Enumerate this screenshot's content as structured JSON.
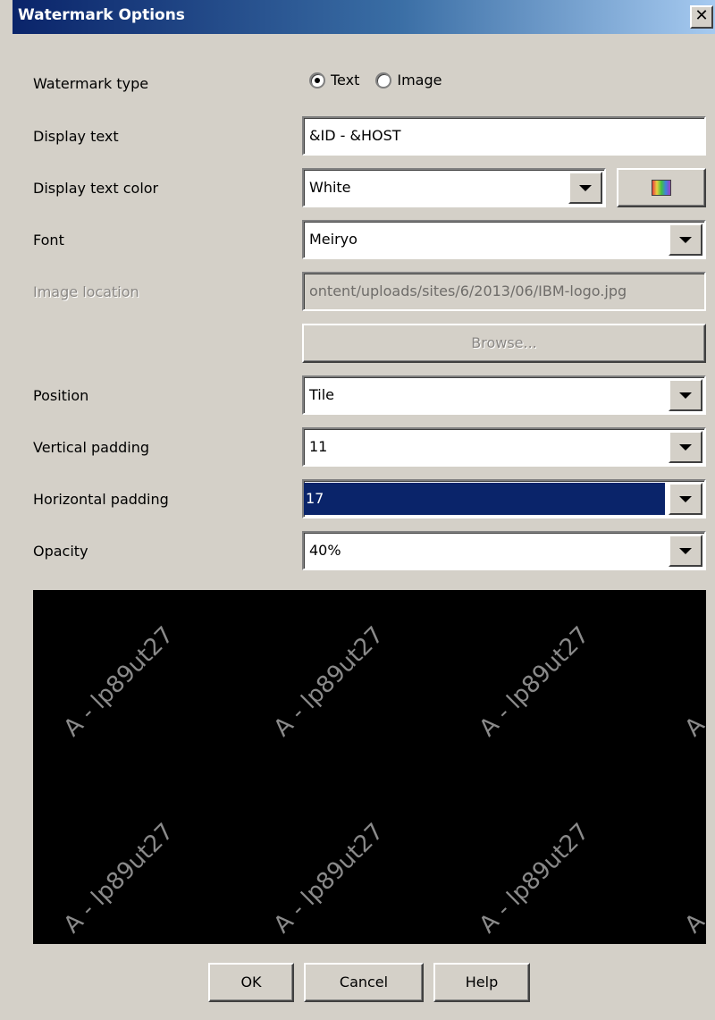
{
  "window": {
    "title": "Watermark Options",
    "close_glyph": "✕"
  },
  "form": {
    "watermark_type": {
      "label": "Watermark type",
      "options": [
        {
          "label": "Text",
          "selected": true
        },
        {
          "label": "Image",
          "selected": false
        }
      ]
    },
    "display_text": {
      "label": "Display text",
      "value": "&ID - &HOST"
    },
    "display_text_color": {
      "label": "Display text color",
      "value": "White",
      "picker_icon": "color-palette-icon"
    },
    "font": {
      "label": "Font",
      "value": "Meiryo"
    },
    "image_location": {
      "label": "Image location",
      "value": "ontent/uploads/sites/6/2013/06/IBM-logo.jpg",
      "enabled": false
    },
    "browse_button": {
      "label": "Browse...",
      "enabled": false
    },
    "position": {
      "label": "Position",
      "value": "Tile"
    },
    "vertical_padding": {
      "label": "Vertical padding",
      "value": "11"
    },
    "horizontal_padding": {
      "label": "Horizontal padding",
      "value": "17",
      "selected": true
    },
    "opacity": {
      "label": "Opacity",
      "value": "40%"
    }
  },
  "preview": {
    "background": "#000000",
    "watermark_text": "A - lp89ut27"
  },
  "buttons": {
    "ok": "OK",
    "cancel": "Cancel",
    "help": "Help"
  },
  "colors": {
    "title_start": "#0a246a",
    "title_end": "#a6caf0",
    "selection": "#0a246a",
    "face": "#d4d0c8"
  }
}
